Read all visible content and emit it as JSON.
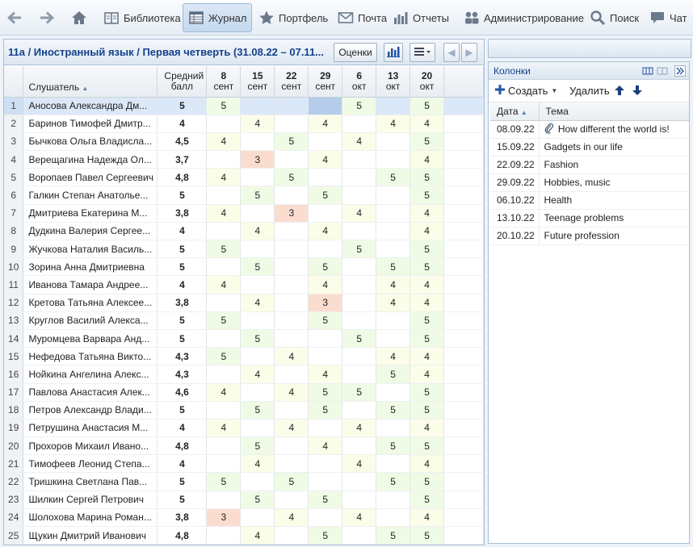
{
  "toolbar": {
    "library": "Библиотека",
    "journal": "Журнал",
    "portfolio": "Портфель",
    "mail": "Почта",
    "reports": "Отчеты",
    "admin": "Администрирование",
    "search": "Поиск",
    "chat": "Чат"
  },
  "header": {
    "breadcrumb": "11а / Иностранный язык / Первая четверть (31.08.22 – 07.11...",
    "grades_button": "Оценки"
  },
  "grid": {
    "col_student": "Слушатель",
    "col_avg": "Средний балл",
    "dates": [
      {
        "day": "8",
        "month": "сент"
      },
      {
        "day": "15",
        "month": "сент"
      },
      {
        "day": "22",
        "month": "сент"
      },
      {
        "day": "29",
        "month": "сент"
      },
      {
        "day": "6",
        "month": "окт"
      },
      {
        "day": "13",
        "month": "окт"
      },
      {
        "day": "20",
        "month": "окт"
      }
    ],
    "rows": [
      {
        "n": "1",
        "name": "Аносова Александра Дм...",
        "avg": "5",
        "marks": [
          "5",
          "",
          "",
          "",
          "5",
          "",
          "5"
        ]
      },
      {
        "n": "2",
        "name": "Баринов Тимофей Дмитр...",
        "avg": "4",
        "marks": [
          "",
          "4",
          "",
          "4",
          "",
          "4",
          "4"
        ]
      },
      {
        "n": "3",
        "name": "Бычкова Ольга Владисла...",
        "avg": "4,5",
        "marks": [
          "4",
          "",
          "5",
          "",
          "4",
          "",
          "5"
        ]
      },
      {
        "n": "4",
        "name": "Верещагина Надежда Ол...",
        "avg": "3,7",
        "marks": [
          "",
          "3",
          "",
          "4",
          "",
          "",
          "4"
        ]
      },
      {
        "n": "5",
        "name": "Воропаев Павел Сергеевич",
        "avg": "4,8",
        "marks": [
          "4",
          "",
          "5",
          "",
          "",
          "5",
          "5"
        ]
      },
      {
        "n": "6",
        "name": "Галкин Степан Анатолье...",
        "avg": "5",
        "marks": [
          "",
          "5",
          "",
          "5",
          "",
          "",
          "5"
        ]
      },
      {
        "n": "7",
        "name": "Дмитриева Екатерина М...",
        "avg": "3,8",
        "marks": [
          "4",
          "",
          "3",
          "",
          "4",
          "",
          "4"
        ]
      },
      {
        "n": "8",
        "name": "Дудкина Валерия Сергее...",
        "avg": "4",
        "marks": [
          "",
          "4",
          "",
          "4",
          "",
          "",
          "4"
        ]
      },
      {
        "n": "9",
        "name": "Жучкова Наталия Василь...",
        "avg": "5",
        "marks": [
          "5",
          "",
          "",
          "",
          "5",
          "",
          "5"
        ]
      },
      {
        "n": "10",
        "name": "Зорина Анна Дмитриевна",
        "avg": "5",
        "marks": [
          "",
          "5",
          "",
          "5",
          "",
          "5",
          "5"
        ]
      },
      {
        "n": "11",
        "name": "Иванова Тамара Андрее...",
        "avg": "4",
        "marks": [
          "4",
          "",
          "",
          "4",
          "",
          "4",
          "4"
        ]
      },
      {
        "n": "12",
        "name": "Кретова Татьяна Алексее...",
        "avg": "3,8",
        "marks": [
          "",
          "4",
          "",
          "3",
          "",
          "4",
          "4"
        ]
      },
      {
        "n": "13",
        "name": "Круглов Василий Алекса...",
        "avg": "5",
        "marks": [
          "5",
          "",
          "",
          "5",
          "",
          "",
          "5"
        ]
      },
      {
        "n": "14",
        "name": "Муромцева Варвара Анд...",
        "avg": "5",
        "marks": [
          "",
          "5",
          "",
          "",
          "5",
          "",
          "5"
        ]
      },
      {
        "n": "15",
        "name": "Нефедова Татьяна Викто...",
        "avg": "4,3",
        "marks": [
          "5",
          "",
          "4",
          "",
          "",
          "4",
          "4"
        ]
      },
      {
        "n": "16",
        "name": "Нойкина Ангелина Алекс...",
        "avg": "4,3",
        "marks": [
          "",
          "4",
          "",
          "4",
          "",
          "5",
          "4"
        ]
      },
      {
        "n": "17",
        "name": "Павлова Анастасия Алек...",
        "avg": "4,6",
        "marks": [
          "4",
          "",
          "4",
          "5",
          "5",
          "",
          "5"
        ]
      },
      {
        "n": "18",
        "name": "Петров Александр Влади...",
        "avg": "5",
        "marks": [
          "",
          "5",
          "",
          "5",
          "",
          "5",
          "5"
        ]
      },
      {
        "n": "19",
        "name": "Петрушина Анастасия М...",
        "avg": "4",
        "marks": [
          "4",
          "",
          "4",
          "",
          "4",
          "",
          "4"
        ]
      },
      {
        "n": "20",
        "name": "Прохоров Михаил Ивано...",
        "avg": "4,8",
        "marks": [
          "",
          "5",
          "",
          "4",
          "",
          "5",
          "5"
        ]
      },
      {
        "n": "21",
        "name": "Тимофеев Леонид Степа...",
        "avg": "4",
        "marks": [
          "",
          "4",
          "",
          "",
          "4",
          "",
          "4"
        ]
      },
      {
        "n": "22",
        "name": "Тришкина Светлана Пав...",
        "avg": "5",
        "marks": [
          "5",
          "",
          "5",
          "",
          "",
          "5",
          "5"
        ]
      },
      {
        "n": "23",
        "name": "Шилкин Сергей Петрович",
        "avg": "5",
        "marks": [
          "",
          "5",
          "",
          "5",
          "",
          "",
          "5"
        ]
      },
      {
        "n": "24",
        "name": "Шолохова Марина Роман...",
        "avg": "3,8",
        "marks": [
          "3",
          "",
          "4",
          "",
          "4",
          "",
          "4"
        ]
      },
      {
        "n": "25",
        "name": "Щукин Дмитрий Иванович",
        "avg": "4,8",
        "marks": [
          "",
          "4",
          "",
          "5",
          "",
          "5",
          "5"
        ]
      }
    ]
  },
  "columns_panel": {
    "title": "Колонки",
    "create": "Создать",
    "delete": "Удалить",
    "col_date": "Дата",
    "col_topic": "Тема",
    "items": [
      {
        "date": "08.09.22",
        "topic": "How different the world is!"
      },
      {
        "date": "15.09.22",
        "topic": "Gadgets in our life"
      },
      {
        "date": "22.09.22",
        "topic": "Fashion"
      },
      {
        "date": "29.09.22",
        "topic": "Hobbies, music"
      },
      {
        "date": "06.10.22",
        "topic": "Health"
      },
      {
        "date": "13.10.22",
        "topic": "Teenage problems"
      },
      {
        "date": "20.10.22",
        "topic": "Future profession"
      }
    ]
  },
  "colors": {
    "grade5": "#f0fbe6",
    "grade4": "#fbfde9",
    "grade3": "#fbddd0",
    "accent": "#15428b"
  }
}
